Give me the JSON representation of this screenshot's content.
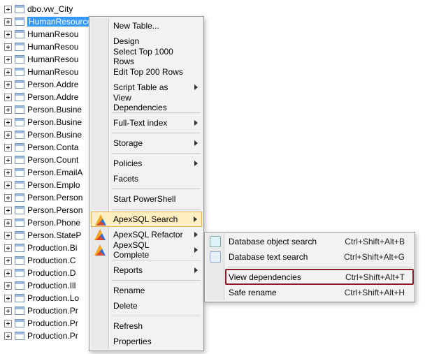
{
  "tree": {
    "items": [
      "dbo.vw_City",
      "HumanResources.Department",
      "HumanResou",
      "HumanResou",
      "HumanResou",
      "HumanResou",
      "Person.Addre",
      "Person.Addre",
      "Person.Busine",
      "Person.Busine",
      "Person.Busine",
      "Person.Conta",
      "Person.Count",
      "Person.EmailA",
      "Person.Emplo",
      "Person.Person",
      "Person.Person",
      "Person.Phone",
      "Person.StateP",
      "Production.Bi",
      "Production.C",
      "Production.D",
      "Production.Ill",
      "Production.Lo",
      "Production.Pr",
      "Production.Pr",
      "Production.Pr"
    ],
    "selected_index": 1
  },
  "menu": {
    "new_table": "New Table...",
    "design": "Design",
    "select_1000": "Select Top 1000 Rows",
    "edit_200": "Edit Top 200 Rows",
    "script_table_as": "Script Table as",
    "view_dependencies": "View Dependencies",
    "full_text_index": "Full-Text index",
    "storage": "Storage",
    "policies": "Policies",
    "facets": "Facets",
    "start_powershell": "Start PowerShell",
    "apexsql_search": "ApexSQL Search",
    "apexsql_refactor": "ApexSQL Refactor",
    "apexsql_complete": "ApexSQL Complete",
    "reports": "Reports",
    "rename": "Rename",
    "delete": "Delete",
    "refresh": "Refresh",
    "properties": "Properties"
  },
  "submenu": {
    "items": [
      {
        "label": "Database object search",
        "shortcut": "Ctrl+Shift+Alt+B"
      },
      {
        "label": "Database text search",
        "shortcut": "Ctrl+Shift+Alt+G"
      },
      {
        "label": "View dependencies",
        "shortcut": "Ctrl+Shift+Alt+T"
      },
      {
        "label": "Safe rename",
        "shortcut": "Ctrl+Shift+Alt+H"
      }
    ],
    "highlighted_index": 2
  }
}
